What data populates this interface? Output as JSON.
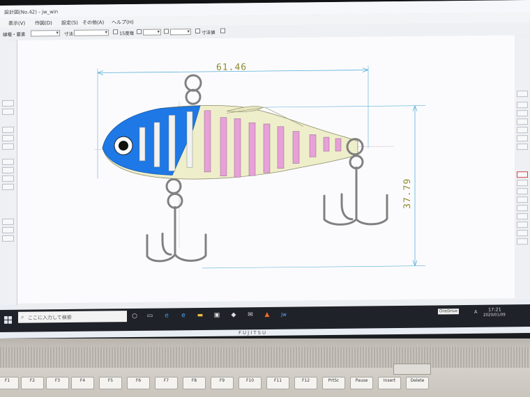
{
  "window": {
    "title": "設計図(No.42) - jw_win",
    "menus": [
      "表示(V)",
      "作図(D)",
      "設定(S)",
      "その他(A)",
      "ヘルプ(H)"
    ]
  },
  "toolbar": {
    "label_left": "線種・要素",
    "label_mode": "寸法",
    "chk1_label": "15度毎",
    "chk4_label": "寸法値"
  },
  "drawing": {
    "dim_width": "61.46",
    "dim_height": "37.79",
    "colors": {
      "body_fill": "#eeeecb",
      "head_fill": "#1e78e6",
      "stripe_white": "#f2f2f2",
      "stripe_pink": "#e7a0d8",
      "dimension": "#5ab0d8",
      "dim_text": "#8d8a2e",
      "hook": "#808080"
    }
  },
  "taskbar": {
    "search_placeholder": "ここに入力して検索",
    "time": "17:21",
    "date": "2020/01/09",
    "ime": "A",
    "notify_label": "OneDrive"
  },
  "laptop": {
    "brand": "FUJITSU",
    "keys": [
      "F1",
      "F2",
      "F3",
      "F4",
      "F5",
      "F6",
      "F7",
      "F8",
      "F9",
      "F10",
      "F11",
      "F12",
      "PrtSc",
      "Pause",
      "Insert",
      "Delete"
    ]
  }
}
